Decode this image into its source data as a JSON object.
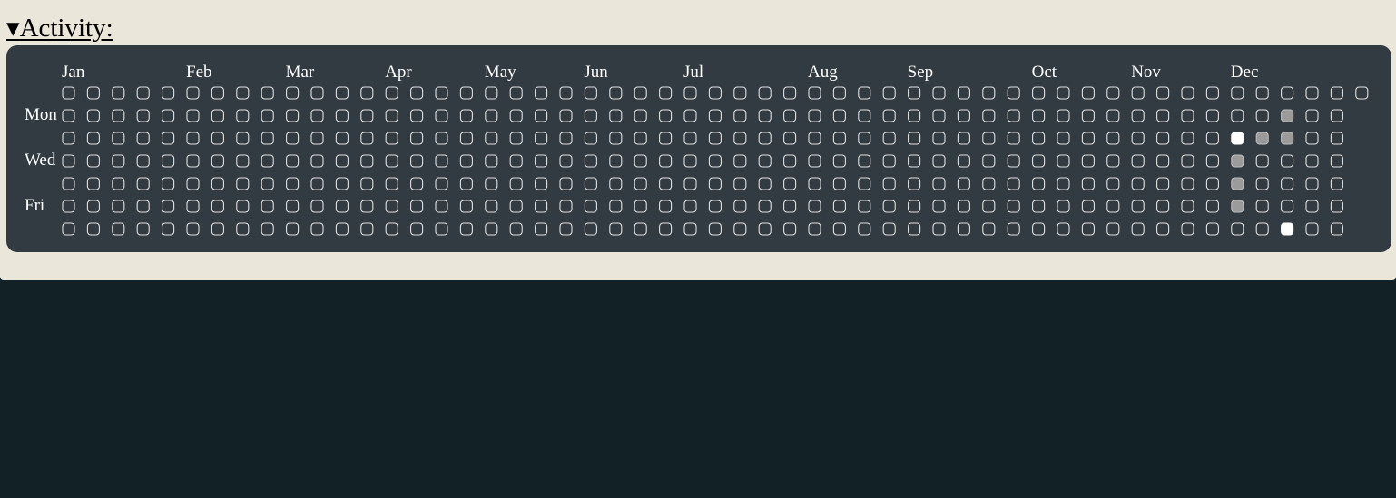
{
  "section": {
    "toggle_icon": "▾",
    "title": "Activity:"
  },
  "activity_graph": {
    "weeks": 53,
    "first_weekday": 0,
    "months": [
      {
        "label": "Jan",
        "week": 0
      },
      {
        "label": "Feb",
        "week": 5
      },
      {
        "label": "Mar",
        "week": 9
      },
      {
        "label": "Apr",
        "week": 13
      },
      {
        "label": "May",
        "week": 17
      },
      {
        "label": "Jun",
        "week": 21
      },
      {
        "label": "Jul",
        "week": 25
      },
      {
        "label": "Aug",
        "week": 30
      },
      {
        "label": "Sep",
        "week": 34
      },
      {
        "label": "Oct",
        "week": 39
      },
      {
        "label": "Nov",
        "week": 43
      },
      {
        "label": "Dec",
        "week": 47
      }
    ],
    "day_labels": [
      {
        "label": "Mon",
        "row": 1
      },
      {
        "label": "Wed",
        "row": 3
      },
      {
        "label": "Fri",
        "row": 5
      }
    ],
    "level_colors": {
      "empty_stroke": "#e2e2e2",
      "medium": "#9b9b9b",
      "high": "#ffffff"
    },
    "active_days": [
      {
        "week": 49,
        "row": 6,
        "level": 4
      },
      {
        "week": 47,
        "row": 2,
        "level": 4
      },
      {
        "week": 47,
        "row": 3,
        "level": 2
      },
      {
        "week": 47,
        "row": 4,
        "level": 2
      },
      {
        "week": 47,
        "row": 5,
        "level": 2
      },
      {
        "week": 48,
        "row": 2,
        "level": 2
      },
      {
        "week": 49,
        "row": 1,
        "level": 2
      },
      {
        "week": 49,
        "row": 2,
        "level": 2
      }
    ]
  }
}
